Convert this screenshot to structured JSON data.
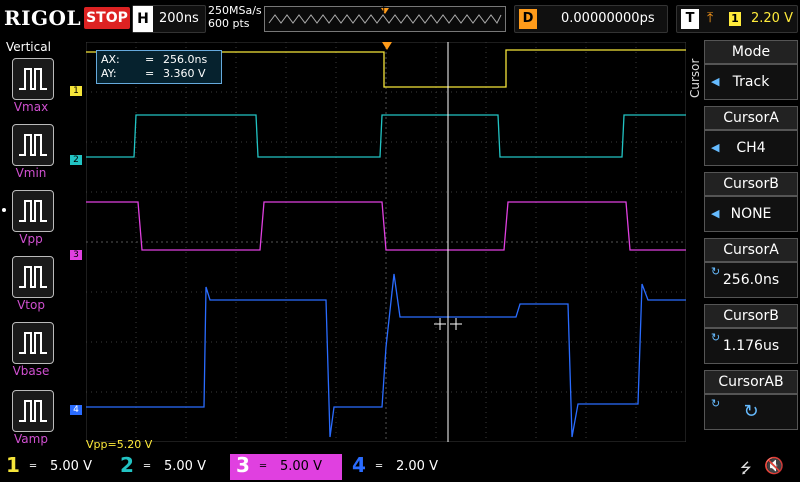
{
  "header": {
    "logo": "RIGOL",
    "run_state": "STOP",
    "horizontal_label": "H",
    "timebase": "200ns",
    "sample_rate": "250MSa/s",
    "memory_depth": "600 pts",
    "trigger_marker": "T",
    "delay_label": "D",
    "delay_value": "0.00000000ps",
    "trigger_label": "T",
    "trigger_channel": "1",
    "trigger_level": "2.20 V"
  },
  "left_panel": {
    "title": "Vertical",
    "buttons": [
      {
        "label": "Vmax"
      },
      {
        "label": "Vmin"
      },
      {
        "label": "Vpp"
      },
      {
        "label": "Vtop"
      },
      {
        "label": "Vbase"
      },
      {
        "label": "Vamp"
      }
    ]
  },
  "cursor_readout": {
    "ax_label": "AX:",
    "ax_value": "256.0ns",
    "ay_label": "AY:",
    "ay_value": "3.360 V",
    "equals": "="
  },
  "measurement": {
    "text": "Vpp=5.20 V"
  },
  "channel_markers": [
    "1",
    "2",
    "3",
    "4"
  ],
  "right_menu": {
    "side_label": "Cursor",
    "items": [
      {
        "title": "Mode",
        "value": "Track",
        "selector": true
      },
      {
        "title": "CursorA",
        "value": "CH4",
        "selector": true
      },
      {
        "title": "CursorB",
        "value": "NONE",
        "selector": true
      },
      {
        "title": "CursorA",
        "value": "256.0ns",
        "selector": false,
        "knob": true
      },
      {
        "title": "CursorB",
        "value": "1.176us",
        "selector": false,
        "knob": true
      },
      {
        "title": "CursorAB",
        "value": "",
        "selector": false,
        "knob": true
      }
    ]
  },
  "channels": [
    {
      "num": "1",
      "scale": "5.00 V",
      "color": "#f5e53a"
    },
    {
      "num": "2",
      "scale": "5.00 V",
      "color": "#22c3c3"
    },
    {
      "num": "3",
      "scale": "5.00 V",
      "color": "#e040e0"
    },
    {
      "num": "4",
      "scale": "2.00 V",
      "color": "#2a6cff"
    }
  ],
  "colors": {
    "ch1": "#f5e53a",
    "ch2": "#22c3c3",
    "ch3": "#e040e0",
    "ch4": "#2a6cff",
    "trigger": "#ff9b1a",
    "grid": "#3a3a3a"
  }
}
